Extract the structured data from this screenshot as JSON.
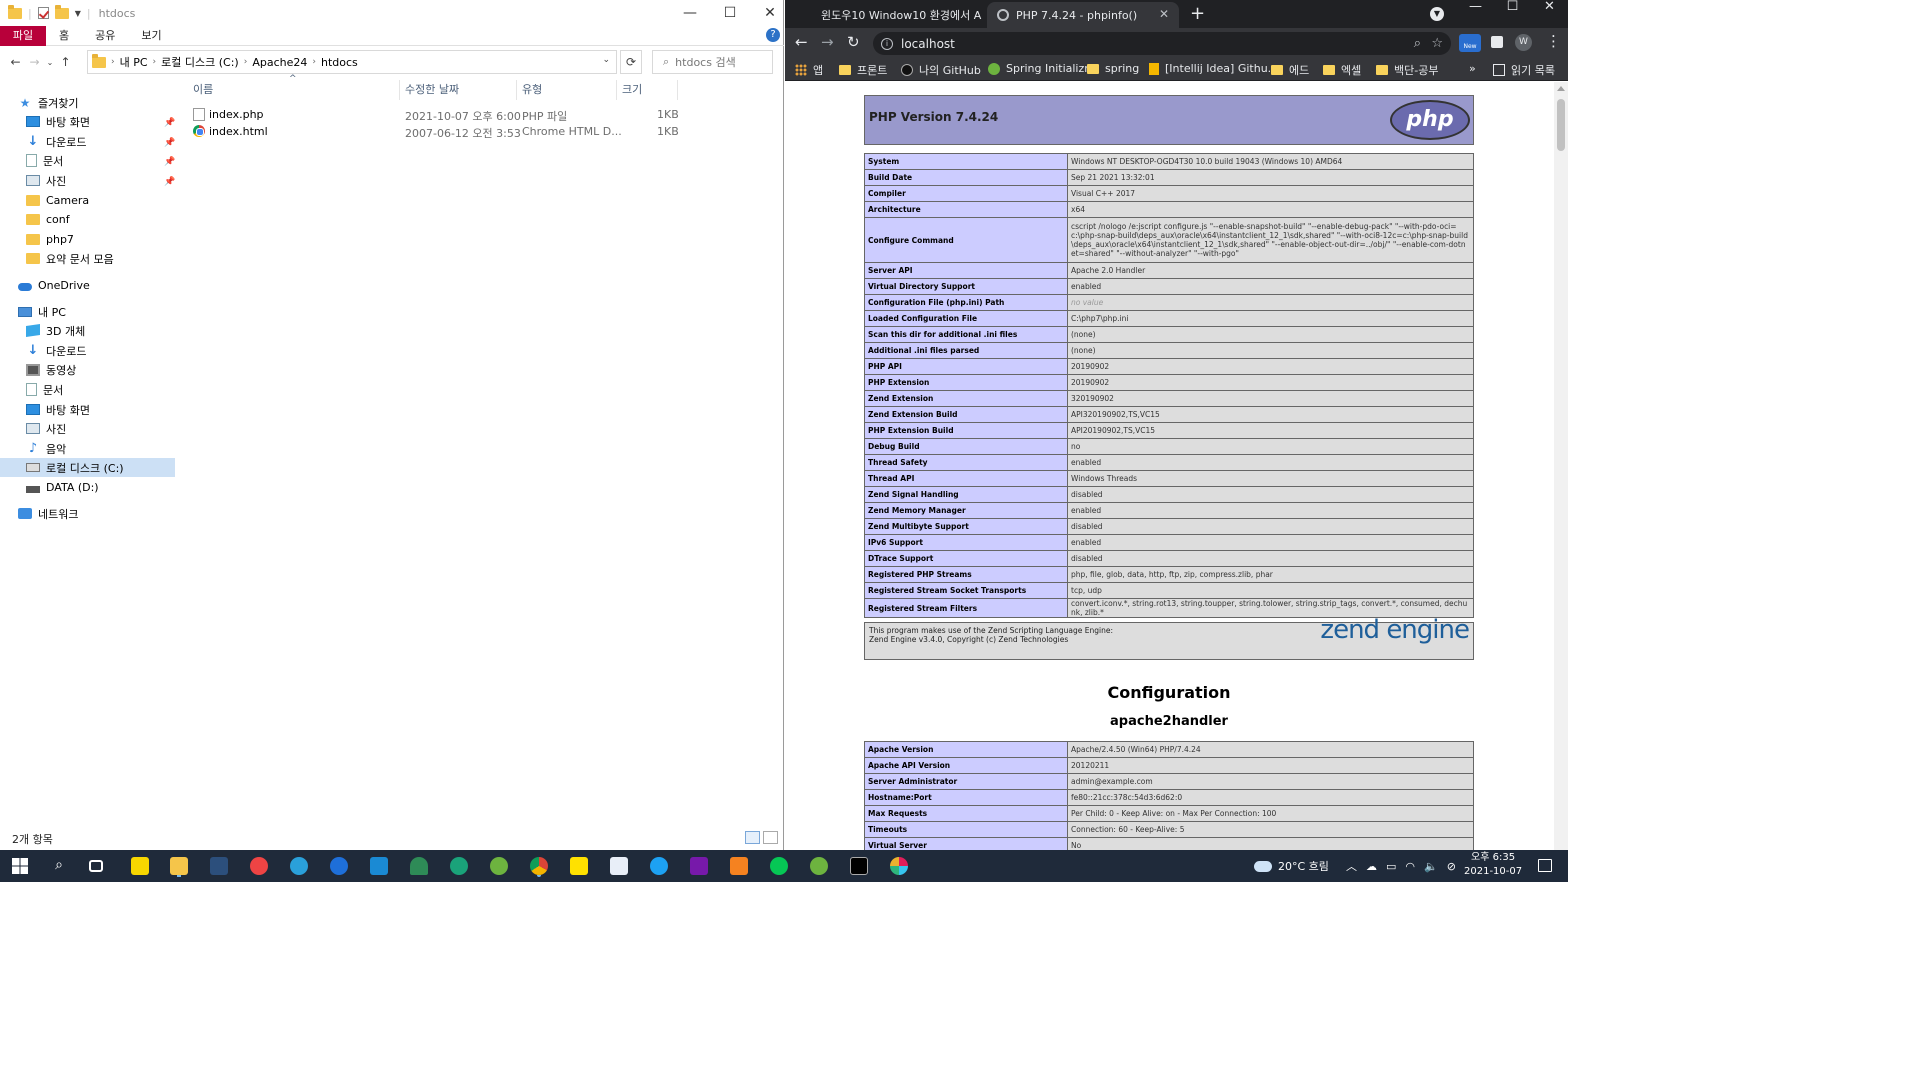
{
  "explorer": {
    "window_title": "htdocs",
    "ribbon": {
      "file": "파일",
      "home": "홈",
      "share": "공유",
      "view": "보기",
      "help": "?"
    },
    "address": {
      "root": "내 PC",
      "drive": "로컬 디스크 (C:)",
      "folder1": "Apache24",
      "folder2": "htdocs"
    },
    "search_placeholder": "htdocs 검색",
    "nav": {
      "quick_access": "즐겨찾기",
      "qa_items": [
        "바탕 화면",
        "다운로드",
        "문서",
        "사진",
        "Camera",
        "conf",
        "php7",
        "요약 문서 모음"
      ],
      "onedrive": "OneDrive",
      "this_pc": "내 PC",
      "pc_items": [
        "3D 개체",
        "다운로드",
        "동영상",
        "문서",
        "바탕 화면",
        "사진",
        "음악",
        "로컬 디스크 (C:)",
        "DATA (D:)"
      ],
      "network": "네트워크"
    },
    "columns": {
      "name": "이름",
      "modified": "수정한 날짜",
      "type": "유형",
      "size": "크기"
    },
    "files": [
      {
        "name": "index.php",
        "modified": "2021-10-07 오후 6:00",
        "type": "PHP 파일",
        "size": "1KB"
      },
      {
        "name": "index.html",
        "modified": "2007-06-12 오전 3:53",
        "type": "Chrome HTML D...",
        "size": "1KB"
      }
    ],
    "status": "2개 항목"
  },
  "chrome": {
    "tabs": [
      {
        "title": "윈도우10 Window10 환경에서 A"
      },
      {
        "title": "PHP 7.4.24 - phpinfo()"
      }
    ],
    "new_tab": "+",
    "url": "localhost",
    "new_badge": "New",
    "profile_initial": "W",
    "bookmarks": [
      "앱",
      "프론트",
      "나의 GitHub",
      "Spring Initializr",
      "spring",
      "[Intellij Idea] Githu...",
      "에드",
      "엑셀",
      "백단-공부"
    ],
    "bookmarks_more": "»",
    "reading_list": "읽기 목록"
  },
  "phpinfo": {
    "version_heading": "PHP Version 7.4.24",
    "logo_text": "php",
    "rows": [
      [
        "System",
        "Windows NT DESKTOP-OGD4T30 10.0 build 19043 (Windows 10) AMD64"
      ],
      [
        "Build Date",
        "Sep 21 2021 13:32:01"
      ],
      [
        "Compiler",
        "Visual C++ 2017"
      ],
      [
        "Architecture",
        "x64"
      ],
      [
        "Configure Command",
        "cscript /nologo /e:jscript configure.js \"--enable-snapshot-build\" \"--enable-debug-pack\" \"--with-pdo-oci=c:\\php-snap-build\\deps_aux\\oracle\\x64\\instantclient_12_1\\sdk,shared\" \"--with-oci8-12c=c:\\php-snap-build\\deps_aux\\oracle\\x64\\instantclient_12_1\\sdk,shared\" \"--enable-object-out-dir=../obj/\" \"--enable-com-dotnet=shared\" \"--without-analyzer\" \"--with-pgo\""
      ],
      [
        "Server API",
        "Apache 2.0 Handler"
      ],
      [
        "Virtual Directory Support",
        "enabled"
      ],
      [
        "Configuration File (php.ini) Path",
        "no value"
      ],
      [
        "Loaded Configuration File",
        "C:\\php7\\php.ini"
      ],
      [
        "Scan this dir for additional .ini files",
        "(none)"
      ],
      [
        "Additional .ini files parsed",
        "(none)"
      ],
      [
        "PHP API",
        "20190902"
      ],
      [
        "PHP Extension",
        "20190902"
      ],
      [
        "Zend Extension",
        "320190902"
      ],
      [
        "Zend Extension Build",
        "API320190902,TS,VC15"
      ],
      [
        "PHP Extension Build",
        "API20190902,TS,VC15"
      ],
      [
        "Debug Build",
        "no"
      ],
      [
        "Thread Safety",
        "enabled"
      ],
      [
        "Thread API",
        "Windows Threads"
      ],
      [
        "Zend Signal Handling",
        "disabled"
      ],
      [
        "Zend Memory Manager",
        "enabled"
      ],
      [
        "Zend Multibyte Support",
        "disabled"
      ],
      [
        "IPv6 Support",
        "enabled"
      ],
      [
        "DTrace Support",
        "disabled"
      ],
      [
        "Registered PHP Streams",
        "php, file, glob, data, http, ftp, zip, compress.zlib, phar"
      ],
      [
        "Registered Stream Socket Transports",
        "tcp, udp"
      ],
      [
        "Registered Stream Filters",
        "convert.iconv.*, string.rot13, string.toupper, string.tolower, string.strip_tags, convert.*, consumed, dechunk, zlib.*"
      ]
    ],
    "zend_line1": "This program makes use of the Zend Scripting Language Engine:",
    "zend_line2": "Zend Engine v3.4.0, Copyright (c) Zend Technologies",
    "zend_logo": "zend engine",
    "configuration_heading": "Configuration",
    "apache_heading": "apache2handler",
    "apache_rows": [
      [
        "Apache Version",
        "Apache/2.4.50 (Win64) PHP/7.4.24"
      ],
      [
        "Apache API Version",
        "20120211"
      ],
      [
        "Server Administrator",
        "admin@example.com"
      ],
      [
        "Hostname:Port",
        "fe80::21cc:378c:54d3:6d62:0"
      ],
      [
        "Max Requests",
        "Per Child: 0 - Keep Alive: on - Max Per Connection: 100"
      ],
      [
        "Timeouts",
        "Connection: 60 - Keep-Alive: 5"
      ],
      [
        "Virtual Server",
        "No"
      ]
    ]
  },
  "taskbar": {
    "weather": "20°C 흐림",
    "time": "오후 6:35",
    "date": "2021-10-07"
  }
}
